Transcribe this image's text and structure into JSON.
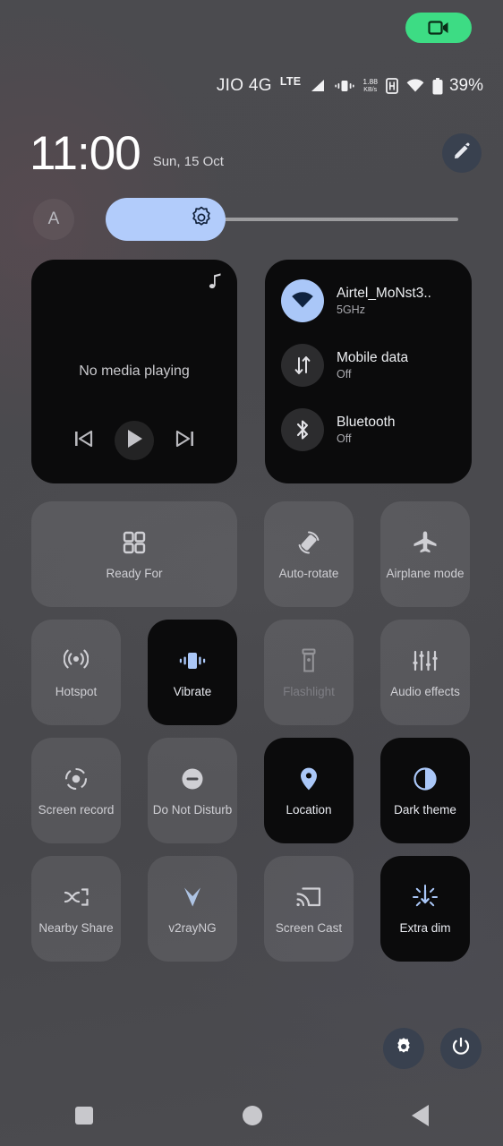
{
  "recording_pill": {
    "icon": "video-camera-icon",
    "color": "#3ddc84"
  },
  "status_bar": {
    "carrier": "JIO 4G",
    "network_type": "LTE",
    "signal_icon": "signal-bars-icon",
    "vibrate_icon": "vibrate-icon",
    "data_rate_value": "1.88",
    "data_rate_unit": "KB/s",
    "hd_icon": "hd-voice-icon",
    "wifi_icon": "wifi-icon",
    "battery_icon": "battery-icon",
    "battery_percent": "39%"
  },
  "header": {
    "time": "11:00",
    "date": "Sun, 15 Oct",
    "edit_icon": "pencil-edit-icon"
  },
  "brightness": {
    "auto_label": "A",
    "auto_icon": "auto-brightness-icon",
    "slider_icon": "brightness-sun-icon",
    "fill_percent": 31,
    "fill_color": "#b2ccfb"
  },
  "media": {
    "note_icon": "music-note-icon",
    "status": "No media playing",
    "prev_icon": "skip-previous-icon",
    "play_icon": "play-icon",
    "next_icon": "skip-next-icon"
  },
  "internet": {
    "rows": [
      {
        "icon": "wifi-icon",
        "title": "Airtel_MoNst3..",
        "sub": "5GHz",
        "active": true
      },
      {
        "icon": "mobile-data-icon",
        "title": "Mobile data",
        "sub": "Off",
        "active": false
      },
      {
        "icon": "bluetooth-icon",
        "title": "Bluetooth",
        "sub": "Off",
        "active": false
      }
    ]
  },
  "tiles": [
    [
      {
        "label": "Ready For",
        "icon": "grid-squares-icon",
        "state": "off",
        "wide": true
      },
      {
        "label": "Auto-rotate",
        "icon": "auto-rotate-icon",
        "state": "off",
        "wide": false
      },
      {
        "label": "Airplane mode",
        "icon": "airplane-icon",
        "state": "off",
        "wide": false
      }
    ],
    [
      {
        "label": "Hotspot",
        "icon": "hotspot-icon",
        "state": "off",
        "wide": false
      },
      {
        "label": "Vibrate",
        "icon": "vibrate-icon",
        "state": "on",
        "wide": false
      },
      {
        "label": "Flashlight",
        "icon": "flashlight-icon",
        "state": "disabled",
        "wide": false
      },
      {
        "label": "Audio effects",
        "icon": "audio-effects-icon",
        "state": "off",
        "wide": false
      }
    ],
    [
      {
        "label": "Screen record",
        "icon": "screen-record-icon",
        "state": "off",
        "wide": false
      },
      {
        "label": "Do Not Disturb",
        "icon": "do-not-disturb-icon",
        "state": "off",
        "wide": false
      },
      {
        "label": "Location",
        "icon": "location-pin-icon",
        "state": "on",
        "wide": false
      },
      {
        "label": "Dark theme",
        "icon": "dark-theme-icon",
        "state": "on",
        "wide": false
      }
    ],
    [
      {
        "label": "Nearby Share",
        "icon": "nearby-share-icon",
        "state": "off",
        "wide": false
      },
      {
        "label": "v2rayNG",
        "icon": "v2rayng-icon",
        "state": "off",
        "wide": false
      },
      {
        "label": "Screen Cast",
        "icon": "screen-cast-icon",
        "state": "off",
        "wide": false
      },
      {
        "label": "Extra dim",
        "icon": "extra-dim-icon",
        "state": "on",
        "wide": false
      }
    ]
  ],
  "footer": {
    "settings_icon": "gear-icon",
    "power_icon": "power-icon"
  },
  "navbar": {
    "recents_icon": "square-recents-icon",
    "home_icon": "circle-home-icon",
    "back_icon": "triangle-back-icon"
  }
}
